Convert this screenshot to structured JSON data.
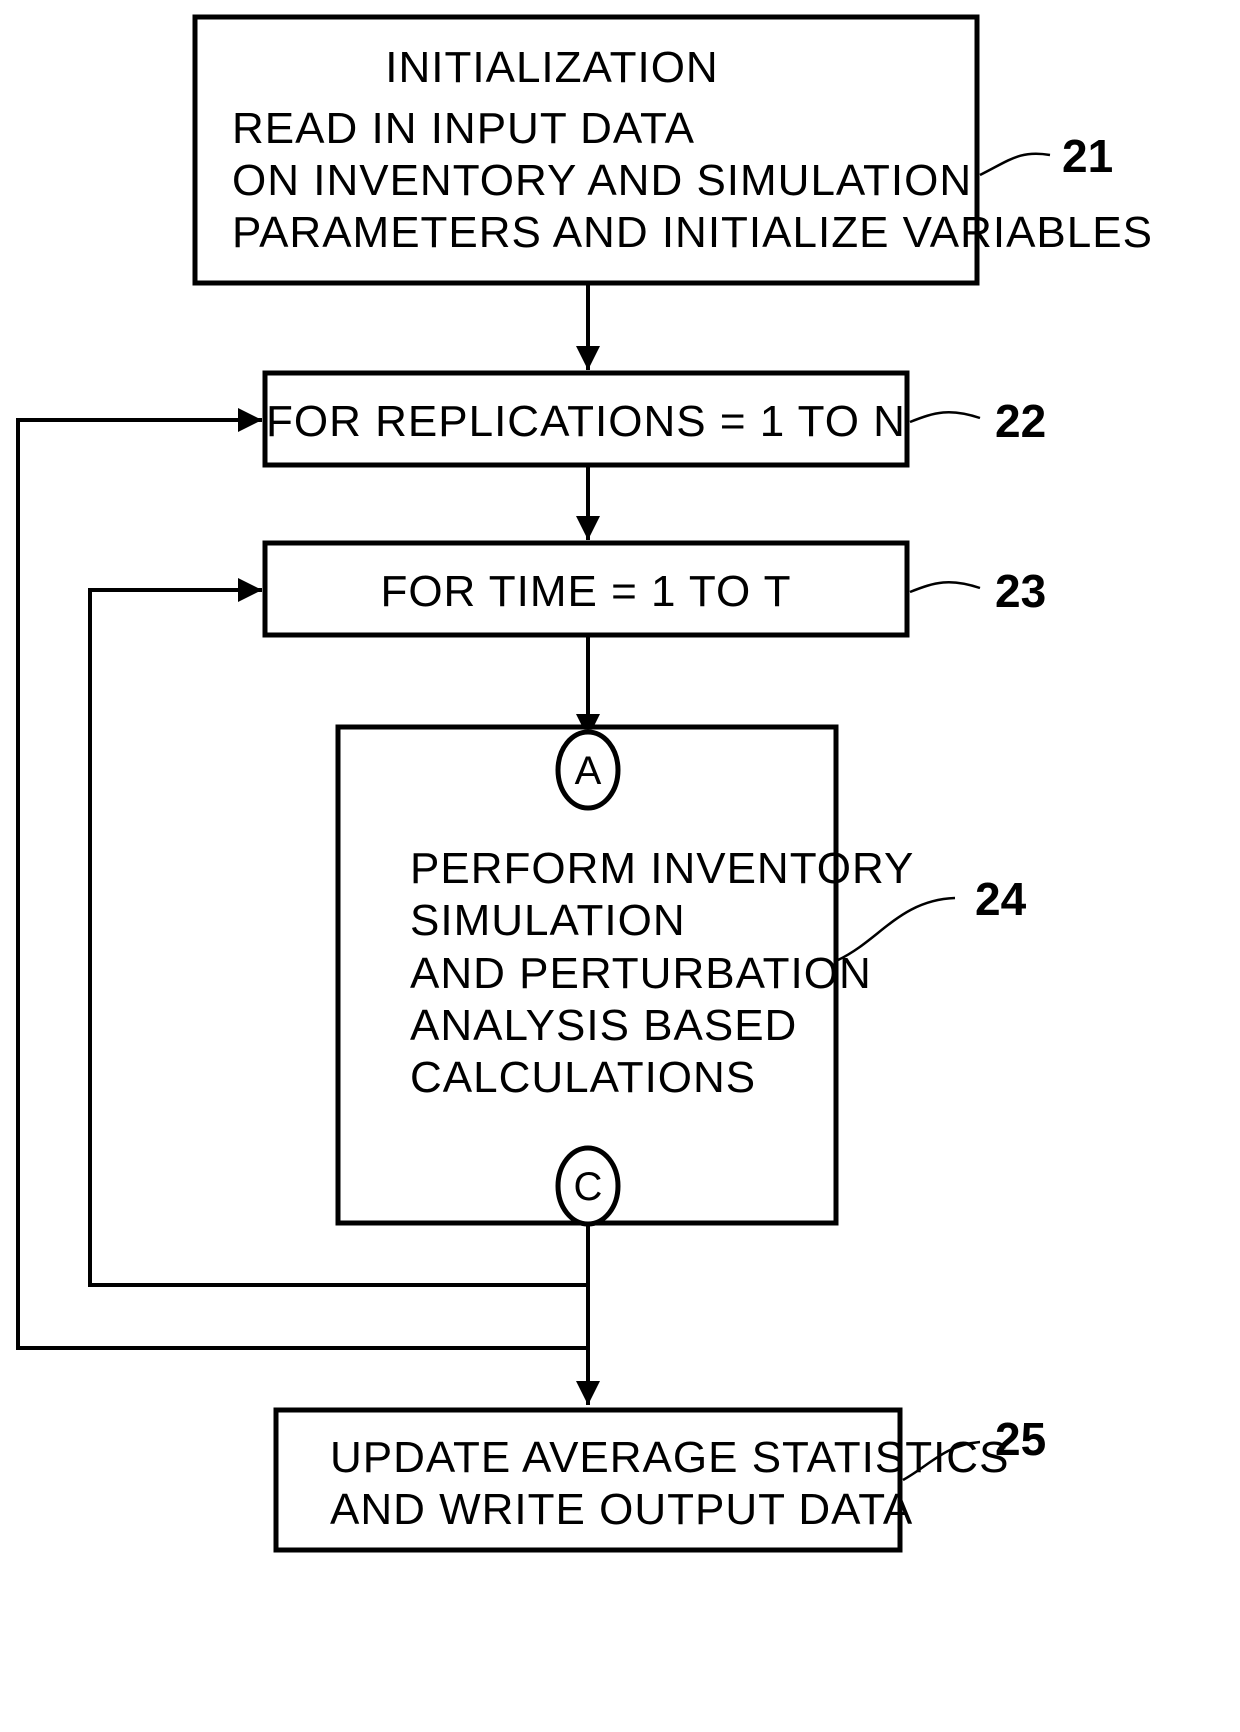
{
  "diagram": {
    "type": "flowchart",
    "steps": [
      {
        "ref": "21",
        "title": "INITIALIZATION",
        "lines": [
          "READ IN INPUT DATA",
          "ON INVENTORY AND SIMULATION",
          "PARAMETERS AND INITIALIZE VARIABLES"
        ]
      },
      {
        "ref": "22",
        "lines": [
          "FOR REPLICATIONS = 1 TO N"
        ]
      },
      {
        "ref": "23",
        "lines": [
          "FOR TIME = 1 TO T"
        ]
      },
      {
        "ref": "24",
        "entry_connector": "A",
        "exit_connector": "C",
        "lines": [
          "PERFORM INVENTORY",
          "SIMULATION",
          "AND PERTURBATION",
          "ANALYSIS BASED",
          "CALCULATIONS"
        ]
      },
      {
        "ref": "25",
        "lines": [
          "UPDATE AVERAGE STATISTICS",
          "AND WRITE OUTPUT DATA"
        ]
      }
    ],
    "edges": [
      {
        "from": "21",
        "to": "22"
      },
      {
        "from": "22",
        "to": "23"
      },
      {
        "from": "23",
        "to": "24"
      },
      {
        "from": "24",
        "to": "23",
        "kind": "loop-back"
      },
      {
        "from": "24",
        "to": "22",
        "kind": "loop-back"
      },
      {
        "from": "24",
        "to": "25"
      }
    ]
  }
}
